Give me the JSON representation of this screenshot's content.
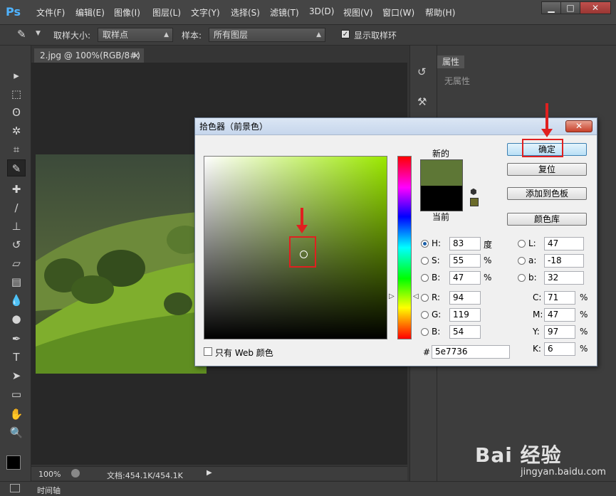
{
  "app": {
    "logo": "Ps"
  },
  "menu": [
    "文件(F)",
    "编辑(E)",
    "图像(I)",
    "图层(L)",
    "文字(Y)",
    "选择(S)",
    "滤镜(T)",
    "3D(D)",
    "视图(V)",
    "窗口(W)",
    "帮助(H)"
  ],
  "window_controls": {
    "minimize": "▁",
    "maximize": "□",
    "close": "✕"
  },
  "options": {
    "sample_size_label": "取样大小:",
    "sample_size_value": "取样点",
    "sample_label": "样本:",
    "sample_value": "所有图层",
    "show_ring_label": "显示取样环",
    "show_ring_checked": true
  },
  "document": {
    "tab_title": "2.jpg @ 100%(RGB/8#)",
    "tab_close": "×"
  },
  "status": {
    "zoom": "100%",
    "doc_info": "文档:454.1K/454.1K"
  },
  "timeline": {
    "label": "时间轴"
  },
  "properties": {
    "tab": "属性",
    "empty_text": "无属性"
  },
  "dialog": {
    "title": "拾色器（前景色）",
    "close": "✕",
    "new_label": "新的",
    "current_label": "当前",
    "new_color": "#5e7736",
    "current_color": "#000000",
    "buttons": {
      "ok": "确定",
      "reset": "复位",
      "add_swatch": "添加到色板",
      "color_libraries": "颜色库"
    },
    "hsb": {
      "h_label": "H:",
      "h": "83",
      "h_unit": "度",
      "s_label": "S:",
      "s": "55",
      "s_unit": "%",
      "b_label": "B:",
      "b": "47",
      "b_unit": "%"
    },
    "rgb": {
      "r_label": "R:",
      "r": "94",
      "g_label": "G:",
      "g": "119",
      "b_label": "B:",
      "b": "54"
    },
    "lab": {
      "l_label": "L:",
      "l": "47",
      "a_label": "a:",
      "a": "-18",
      "b_label": "b:",
      "b": "32"
    },
    "cmyk": {
      "c_label": "C:",
      "c": "71",
      "m_label": "M:",
      "m": "47",
      "y_label": "Y:",
      "y": "97",
      "k_label": "K:",
      "k": "6",
      "unit": "%"
    },
    "hex_label": "#",
    "hex": "5e7736",
    "web_only_label": "只有 Web 颜色"
  },
  "watermark": {
    "brand": "Bai 经验",
    "url": "jingyan.baidu.com"
  }
}
